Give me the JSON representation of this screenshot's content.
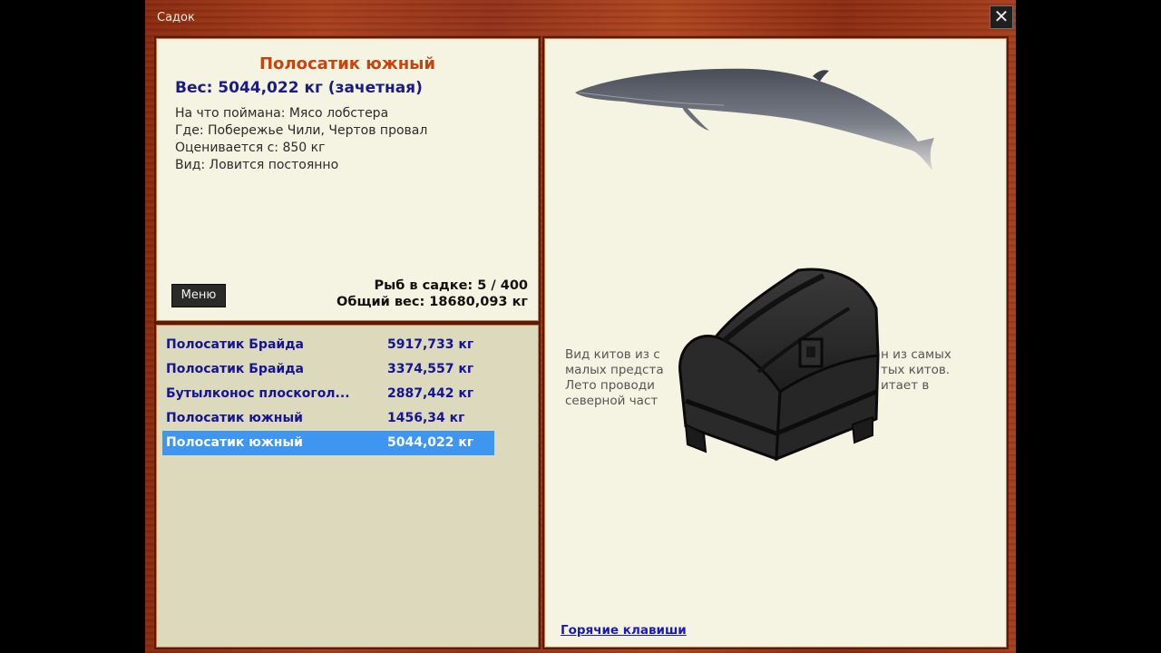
{
  "window": {
    "title": "Садок",
    "close_glyph": "✕"
  },
  "fish": {
    "name": "Полосатик южный",
    "weight_line": "Вес: 5044,022 кг (зачетная)",
    "details": [
      "На что поймана: Мясо лобстера",
      "Где: Побережье Чили, Чертов провал",
      "Оценивается с: 850 кг",
      "Вид: Ловится постоянно"
    ]
  },
  "menu_button": "Меню",
  "stats": {
    "count": "Рыб в садке: 5 / 400",
    "total": "Общий вес: 18680,093 кг"
  },
  "catch_list": [
    {
      "name": "Полосатик Брайда",
      "weight": "5917,733 кг"
    },
    {
      "name": "Полосатик Брайда",
      "weight": "3374,557 кг"
    },
    {
      "name": "Бутылконос плоскогол...",
      "weight": "2887,442 кг"
    },
    {
      "name": "Полосатик южный",
      "weight": "1456,34 кг"
    },
    {
      "name": "Полосатик южный",
      "weight": "5044,022 кг",
      "selected": true
    }
  ],
  "description_lines": [
    "Вид китов из с",
    "малых предста",
    "Лето проводи",
    "северной част"
  ],
  "description_right": [
    "н из самых",
    "тых китов.",
    "итает в"
  ],
  "hotkeys_link": "Горячие клавиши",
  "icons": {
    "whale": "whale-image",
    "chest": "treasure-chest-icon",
    "close": "close-icon"
  }
}
